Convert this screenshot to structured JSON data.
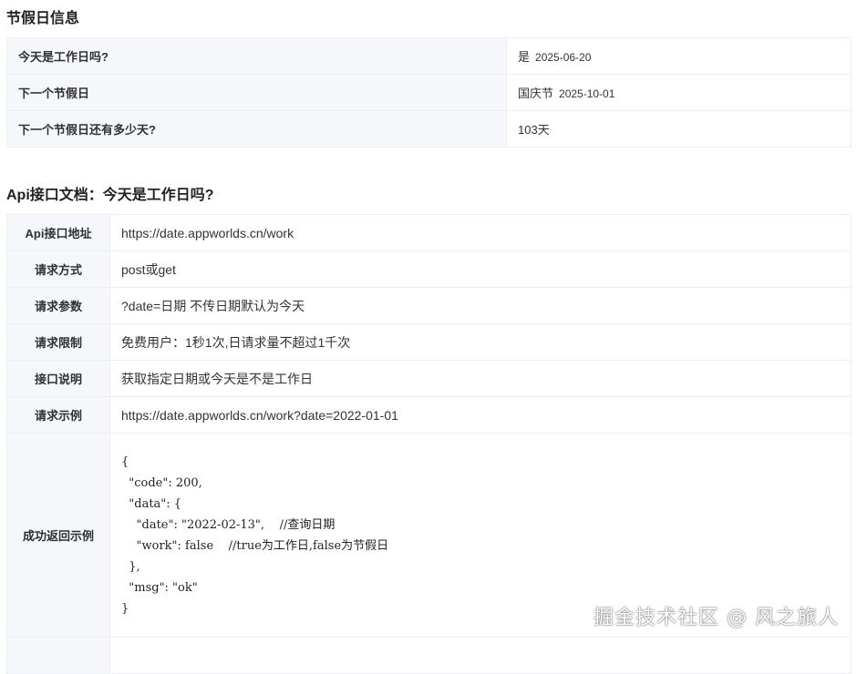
{
  "holiday_section": {
    "title": "节假日信息",
    "rows": [
      {
        "label": "今天是工作日吗?",
        "value": "是",
        "date": "2025-06-20"
      },
      {
        "label": "下一个节假日",
        "value": "国庆节",
        "date": "2025-10-01"
      },
      {
        "label": "下一个节假日还有多少天?",
        "value": "103天",
        "date": ""
      }
    ]
  },
  "api_section": {
    "title": "Api接口文档：今天是工作日吗?",
    "rows": [
      {
        "label": "Api接口地址",
        "value": "https://date.appworlds.cn/work"
      },
      {
        "label": "请求方式",
        "value": "post或get"
      },
      {
        "label": "请求参数",
        "value": "?date=日期 不传日期默认为今天"
      },
      {
        "label": "请求限制",
        "value": "免费用户：1秒1次,日请求量不超过1千次"
      },
      {
        "label": "接口说明",
        "value": "获取指定日期或今天是不是工作日"
      },
      {
        "label": "请求示例",
        "value": "https://date.appworlds.cn/work?date=2022-01-01"
      }
    ],
    "example": {
      "label": "成功返回示例",
      "code": "{\n  \"code\": 200,\n  \"data\": {\n    \"date\": \"2022-02-13\",    //查询日期\n    \"work\": false    //true为工作日,false为节假日\n  },\n  \"msg\": \"ok\"\n}"
    }
  },
  "watermark": "掘金技术社区 @ 风之旅人"
}
